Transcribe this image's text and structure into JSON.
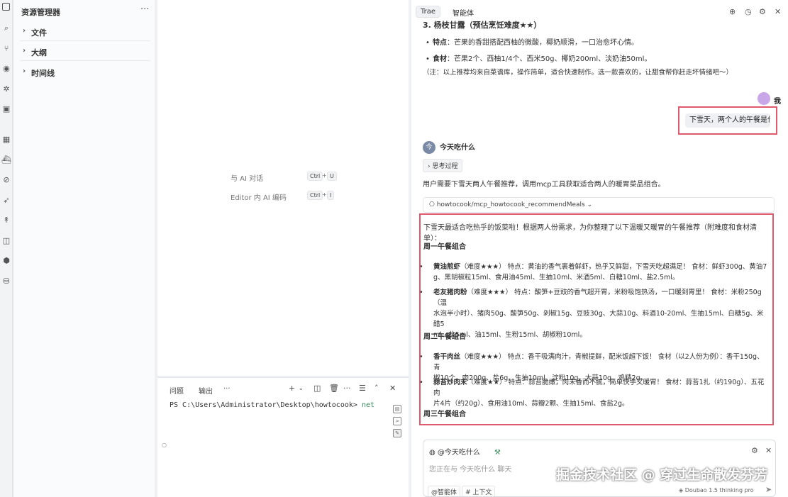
{
  "explorer": {
    "title": "资源管理器",
    "more": "···",
    "sections": [
      {
        "label": "文件"
      },
      {
        "label": "大纲"
      },
      {
        "label": "时间线"
      }
    ]
  },
  "editor": {
    "hints": [
      {
        "label": "与 AI 对话",
        "k1": "Ctrl",
        "plus": "+",
        "k2": "U"
      },
      {
        "label": "Editor 内 AI 编码",
        "k1": "Ctrl",
        "plus": "+",
        "k2": "I"
      }
    ]
  },
  "terminal": {
    "tab_problems": "问题",
    "tab_output": "输出",
    "tab_more": "···",
    "prompt": "PS C:\\Users\\Administrator\\Desktop\\howtocook>",
    "command": "net"
  },
  "chat": {
    "tab_trae": "Trae",
    "tab_agent": "智能体",
    "prev_heading": "3. 杨枝甘露（预估烹饪难度★★）",
    "prev_feature_label": "特点",
    "prev_feature": "：芒果的香甜搭配西柚的微酸，椰奶顺滑，一口治愈坏心情。",
    "prev_ingredients_label": "食材",
    "prev_ingredients": "：芒果2个、西柚1/4个、西米50g、椰奶200ml、淡奶油50ml。",
    "prev_note": "（注：以上推荐均来自菜谱库，操作简单，适合快速制作。选一款喜欢的，让甜食帮你赶走坏情绪吧～）",
    "user_name": "我",
    "user_message": "下雪天，两个人的午餐是什么",
    "bot_name": "今天吃什么",
    "bot_avatar": "今",
    "think_label": "思考过程",
    "bot_intro": "用户需要下雪天两人午餐推荐，调用mcp工具获取适合两人的暖胃菜品组合。",
    "tool_call": "howtocook/mcp_howtocook_recommendMeals",
    "answer": {
      "intro": "下雪天最适合吃热乎的饭菜啦！根据两人份需求，为你整理了以下温暖又暖胃的午餐推荐（附难度和食材清单）：",
      "week1": "周一午餐组合",
      "week1_items": [
        {
          "name": "黄油煎虾",
          "rest": "（难度★★★）  特点：黄油的香气裹着鲜虾，热乎又鲜甜，下雪天吃超满足！ 食材：鲜虾300g、黄油7",
          "rest2": "g、黑胡椒粒15ml、食用油45ml、生抽10ml、米酒5ml、白糖10ml、盐2.5ml。"
        },
        {
          "name": "老友猪肉粉",
          "rest": "（难度★★★）  特点：酸笋+豆豉的香气超开胃，米粉吸饱热汤，一口暖到胃里！ 食材：米粉250g（温",
          "rest2": "水泡半小时）、猪肉50g、酸笋50g、剁椒15g、豆豉30g、大蒜10g、料酒10-20ml、生抽15ml、白糖5g、米醋5",
          "rest3": "ml、盐5ml、油15ml、生粉15ml、胡椒粉10ml。"
        }
      ],
      "week2": "周二午餐组合",
      "week2_items": [
        {
          "name": "香干肉丝",
          "rest": "（难度★★★）  特点：香干吸满肉汁，青椒提鲜，配米饭超下饭！ 食材（以2人份为例）：香干150g、青",
          "rest2": "椒10个、肉200g、盐6g、生抽10ml、淀粉10g、大蒜10g、鸡精2g。"
        },
        {
          "name": "蒜苔炒肉末",
          "rest": "（难度★★）  特点：蒜苔脆嫩，肉末香而不腻，简单快手又暖胃！ 食材：蒜苔1扎（约190g）、五花肉",
          "rest2": "片4片（约20g）、食用油10ml、蒜瓣2颗、生抽15ml、食盐2g。"
        }
      ],
      "week3_partial": "周三午餐组合"
    },
    "input_agent": "@今天吃什么",
    "input_placeholder": "您正在与 今天吃什么 聊天",
    "chip_agent": "@智能体",
    "chip_context": "# 上下文",
    "model": "Doubao 1.5 thinking pro",
    "watermark": "掘金技术社区 @ 穿过生命散发芬芳"
  },
  "colors": {
    "highlight_border": "#e05a6e",
    "panel_bg": "#ffffff",
    "sidebar_bg": "#fafbfc"
  },
  "icons": [
    "explorer-icon",
    "search-icon",
    "source-control-icon",
    "run-debug-icon",
    "extensions-icon",
    "remote-icon",
    "grid-icon",
    "docker-icon",
    "history-icon",
    "gear-icon",
    "send-icon"
  ]
}
